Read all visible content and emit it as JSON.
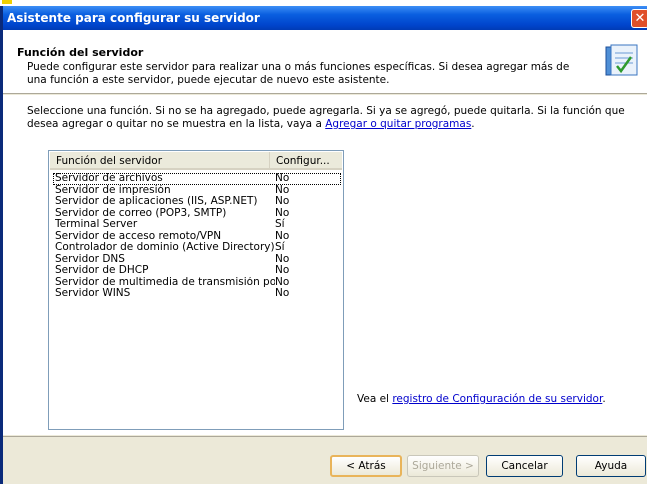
{
  "window": {
    "title": "Asistente para configurar su servidor",
    "close_glyph": "✕"
  },
  "header": {
    "title": "Función del servidor",
    "description": "Puede configurar este servidor para realizar una o más funciones específicas. Si desea agregar más de una función a este servidor, puede ejecutar de nuevo este asistente.",
    "icon": "server-config-icon"
  },
  "body": {
    "intro_text": "Seleccione una función. Si no se ha agregado, puede agregarla. Si ya se agregó, puede quitarla. Si la función que desea agregar o quitar no se muestra en la lista, vaya a ",
    "intro_link": "Agregar o quitar programas",
    "intro_end": ".",
    "list_headers": [
      "Función del servidor",
      "Configur..."
    ],
    "rows": [
      {
        "name": "Servidor de archivos",
        "value": "No"
      },
      {
        "name": "Servidor de impresión",
        "value": "No"
      },
      {
        "name": "Servidor de aplicaciones (IIS, ASP.NET)",
        "value": "No"
      },
      {
        "name": "Servidor de correo (POP3, SMTP)",
        "value": "No"
      },
      {
        "name": "Terminal Server",
        "value": "Sí"
      },
      {
        "name": "Servidor de acceso remoto/VPN",
        "value": "No"
      },
      {
        "name": "Controlador de dominio (Active Directory)",
        "value": "Sí"
      },
      {
        "name": "Servidor DNS",
        "value": "No"
      },
      {
        "name": "Servidor de DHCP",
        "value": "No"
      },
      {
        "name": "Servidor de multimedia de transmisión po...",
        "value": "No"
      },
      {
        "name": "Servidor WINS",
        "value": "No"
      }
    ],
    "log_prefix": "Vea el ",
    "log_link": "registro de Configuración de su servidor",
    "log_suffix": "."
  },
  "buttons": {
    "back": "< Atrás",
    "next": "Siguiente >",
    "cancel": "Cancelar",
    "help": "Ayuda"
  },
  "colors": {
    "titlebar": "#0044cc",
    "dialog_bg": "#ece9d8",
    "link": "#0000cc"
  }
}
